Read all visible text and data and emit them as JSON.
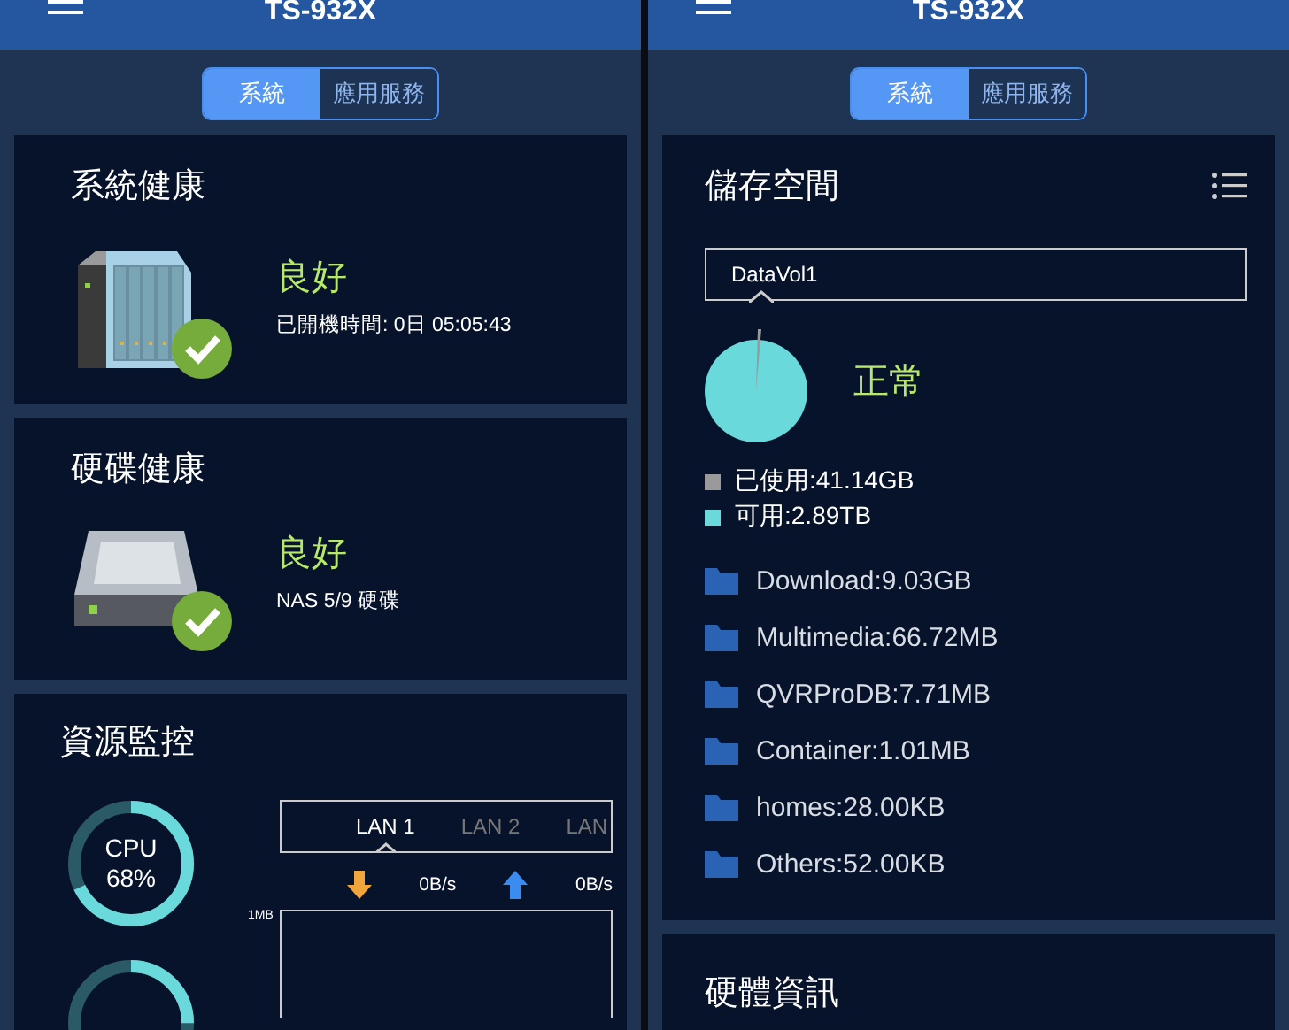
{
  "panes": [
    {
      "header": {
        "title": "TS-932X"
      },
      "tabs": [
        {
          "label": "系統",
          "selected": true
        },
        {
          "label": "應用服務",
          "selected": false
        }
      ],
      "cards": [
        {
          "kind": "system_health",
          "title": "系統健康",
          "status": "良好",
          "detail": "已開機時間: 0日 05:05:43"
        },
        {
          "kind": "disk_health",
          "title": "硬碟健康",
          "status": "良好",
          "detail": "NAS 5/9 硬碟"
        },
        {
          "kind": "resource_monitor",
          "title": "資源監控",
          "gauge": {
            "label": "CPU",
            "value": "68%",
            "level": 0.68
          },
          "lan_tabs": [
            {
              "label": "LAN 1",
              "selected": true
            },
            {
              "label": "LAN 2",
              "selected": false
            },
            {
              "label": "LAN",
              "selected": false
            }
          ],
          "download": "0B/s",
          "upload": "0B/s",
          "y_label": "1MB"
        }
      ]
    },
    {
      "header": {
        "title": "TS-932X"
      },
      "tabs": [
        {
          "label": "系統",
          "selected": true
        },
        {
          "label": "應用服務",
          "selected": false
        }
      ],
      "cards": [
        {
          "kind": "storage",
          "title": "儲存空間",
          "volume": "DataVol1",
          "status": "正常",
          "legend": [
            {
              "label": "已使用:41.14GB",
              "color": "#9a9a9a"
            },
            {
              "label": "可用:2.89TB",
              "color": "#6ad9dc"
            }
          ],
          "folders": [
            "Download:9.03GB",
            "Multimedia:66.72MB",
            "QVRProDB:7.71MB",
            "Container:1.01MB",
            "homes:28.00KB",
            "Others:52.00KB"
          ]
        },
        {
          "kind": "hardware",
          "title": "硬體資訊"
        }
      ]
    }
  ]
}
